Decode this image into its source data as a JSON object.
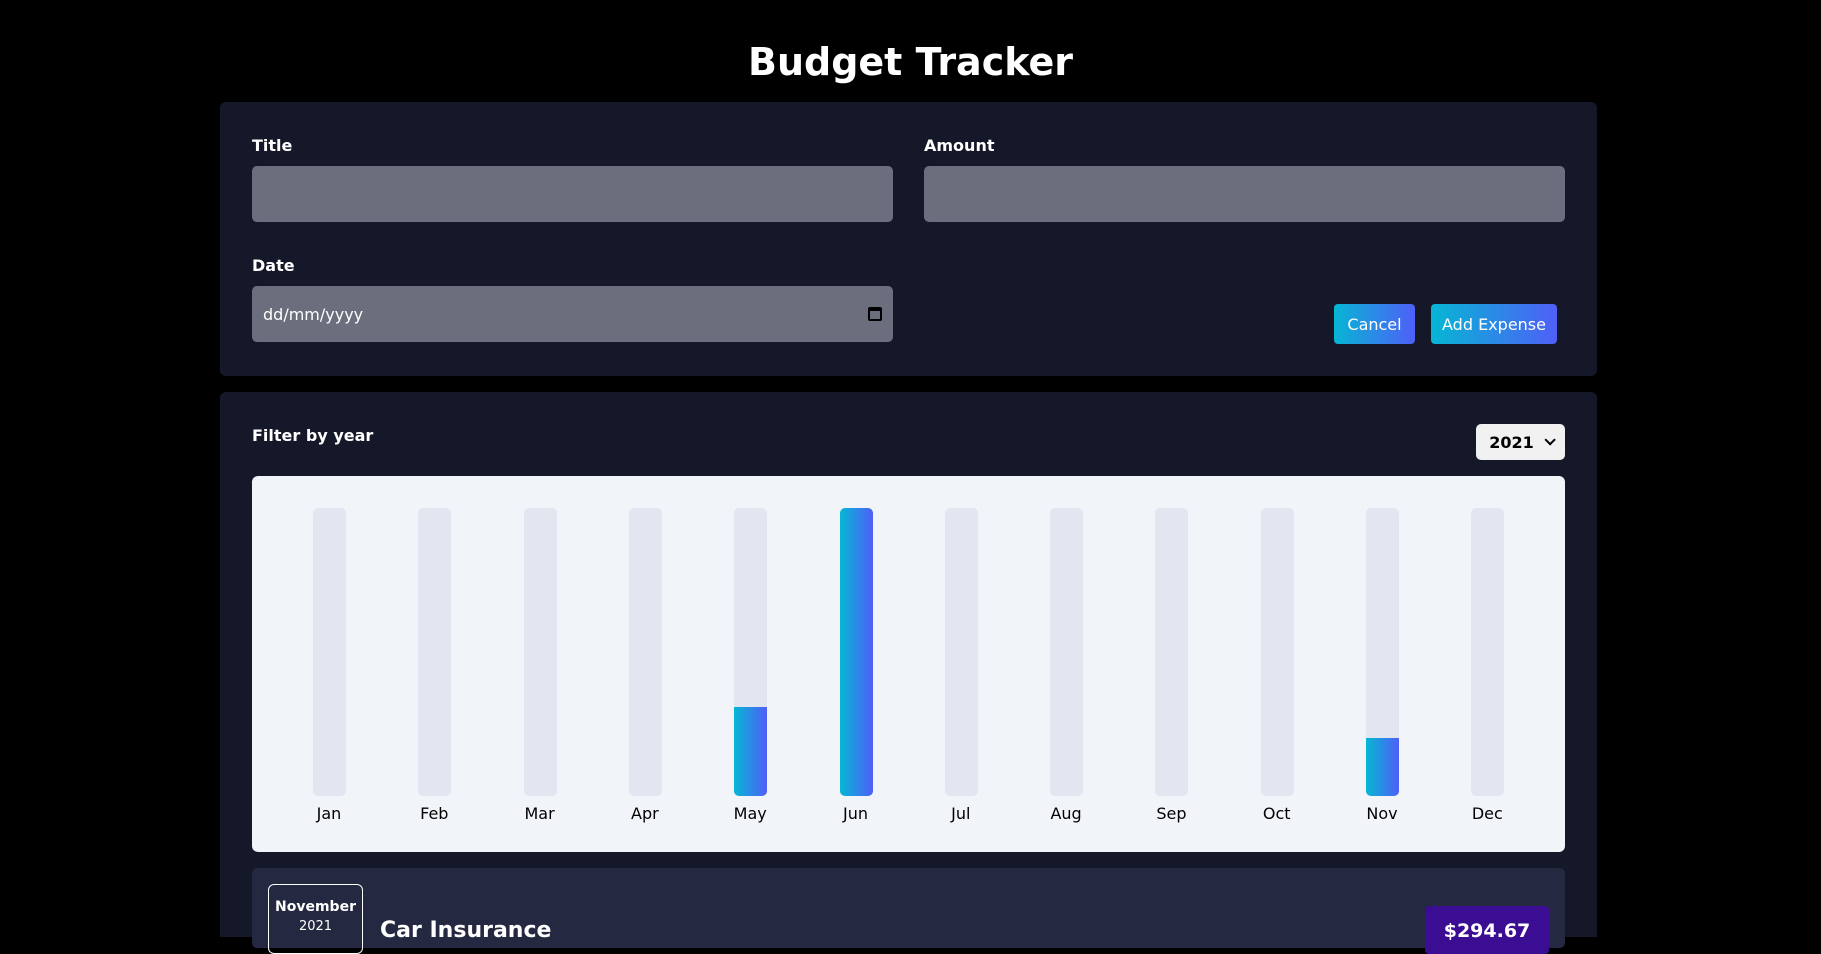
{
  "app": {
    "title": "Budget Tracker"
  },
  "form": {
    "title_label": "Title",
    "title_value": "",
    "amount_label": "Amount",
    "amount_value": "",
    "date_label": "Date",
    "date_placeholder": "dd/mm/yyyy",
    "cancel_label": "Cancel",
    "add_label": "Add Expense"
  },
  "filter": {
    "label": "Filter by year",
    "selected_year": "2021"
  },
  "chart_data": {
    "type": "bar",
    "categories": [
      "Jan",
      "Feb",
      "Mar",
      "Apr",
      "May",
      "Jun",
      "Jul",
      "Aug",
      "Sep",
      "Oct",
      "Nov",
      "Dec"
    ],
    "fill_fractions": [
      0,
      0,
      0,
      0,
      0.31,
      1,
      0,
      0,
      0,
      0,
      0.2,
      0
    ],
    "colors": {
      "track": "#e2e6f0",
      "fill_start": "#06b6d4",
      "fill_end": "#4f5ff8"
    }
  },
  "expenses": [
    {
      "month": "November",
      "year": "2021",
      "title": "Car Insurance",
      "amount": "$294.67"
    }
  ]
}
